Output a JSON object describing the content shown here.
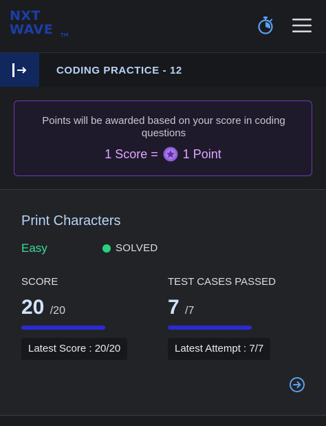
{
  "header": {
    "logo_line1": "NXT",
    "logo_line2": "WAVE",
    "logo_tm": "TM",
    "icons": [
      "timer-icon",
      "hamburger-menu-icon"
    ],
    "brand_color": "#1d3ea8"
  },
  "practice": {
    "title": "CODING PRACTICE - 12",
    "collapse_icon": "sidebar-expand-icon"
  },
  "notice": {
    "message": "Points will be awarded based on your score in coding questions",
    "score_prefix": "1 Score =",
    "score_suffix": "1 Point",
    "coin_icon": "star-coin-icon",
    "accent_color": "#e0a5ff"
  },
  "problem": {
    "title": "Print Characters",
    "difficulty": "Easy",
    "status": "SOLVED",
    "status_color": "#27d37f",
    "score": {
      "label": "SCORE",
      "value": "20",
      "total": "/20",
      "progress": 1.0,
      "latest": "Latest Score : 20/20"
    },
    "test_cases": {
      "label": "TEST CASES PASSED",
      "value": "7",
      "total": "/7",
      "progress": 1.0,
      "latest": "Latest Attempt : 7/7"
    },
    "open_icon": "arrow-right-circle-icon"
  }
}
